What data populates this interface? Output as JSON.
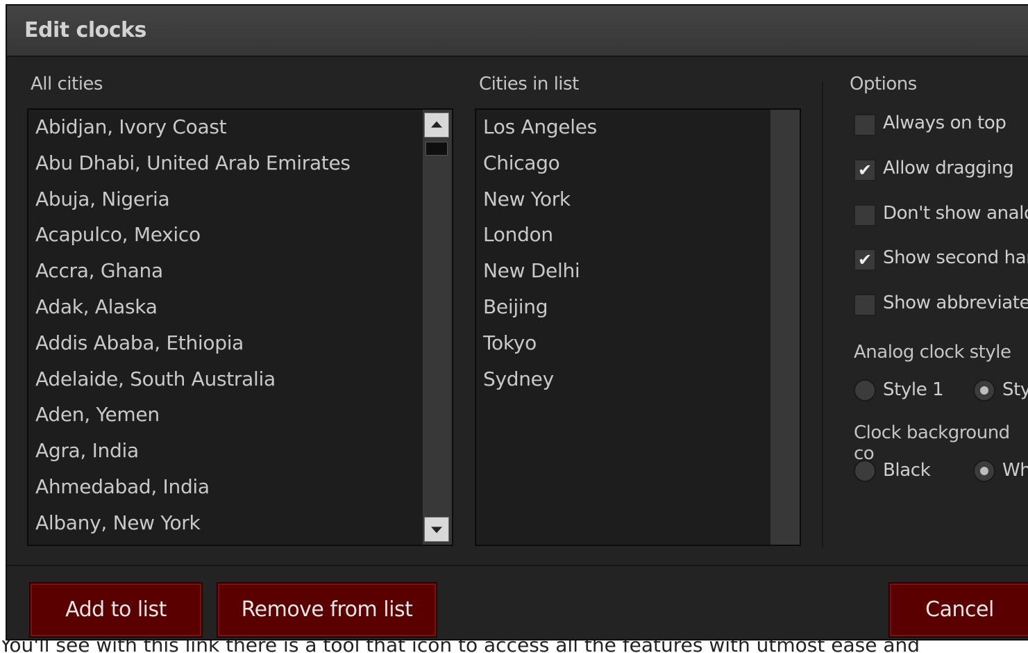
{
  "dialog": {
    "title": "Edit clocks",
    "all_cities_label": "All cities",
    "all_cities": [
      "Abidjan, Ivory Coast",
      "Abu Dhabi, United Arab Emirates",
      "Abuja, Nigeria",
      "Acapulco, Mexico",
      "Accra, Ghana",
      "Adak, Alaska",
      "Addis Ababa, Ethiopia",
      "Adelaide, South Australia",
      "Aden, Yemen",
      "Agra, India",
      "Ahmedabad, India",
      "Albany, New York"
    ],
    "cities_in_list_label": "Cities in list",
    "cities_in_list": [
      "Los Angeles",
      "Chicago",
      "New York",
      "London",
      "New Delhi",
      "Beijing",
      "Tokyo",
      "Sydney"
    ],
    "options": {
      "label": "Options",
      "checkboxes": [
        {
          "label": "Always on top",
          "checked": false
        },
        {
          "label": "Allow dragging",
          "checked": true
        },
        {
          "label": "Don't show analo",
          "checked": false
        },
        {
          "label": "Show second har",
          "checked": true
        },
        {
          "label": "Show abbreviate",
          "checked": false
        }
      ],
      "analog_style_label": "Analog clock style",
      "style_options": [
        "Style 1",
        "Sty"
      ],
      "style_selected": 1,
      "bg_label": "Clock background co",
      "bg_options": [
        "Black",
        "Wh"
      ],
      "bg_selected": 1
    },
    "buttons": {
      "add": "Add to list",
      "remove": "Remove from list",
      "cancel": "Cancel"
    }
  },
  "bottom_text": "You'll see with this link there is a tool that icon to access all the features with utmost ease and"
}
